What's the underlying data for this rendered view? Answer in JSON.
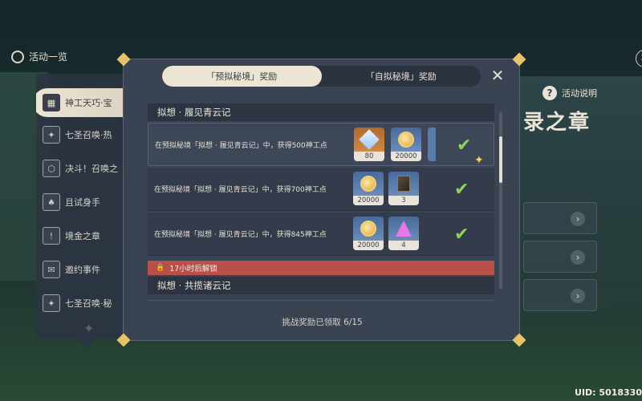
{
  "topbar": {
    "title": "活动一览"
  },
  "background": {
    "panel_title": "录之章",
    "help_label": "活动说明",
    "help_icon_glyph": "?"
  },
  "sidebar": {
    "items": [
      {
        "label": "神工天巧·宝",
        "icon": "grid-icon",
        "glyph": "▦",
        "active": true
      },
      {
        "label": "七圣召唤·热",
        "icon": "card-icon",
        "glyph": "✦"
      },
      {
        "label": "决斗！召唤之",
        "icon": "shield-icon",
        "glyph": "⬡"
      },
      {
        "label": "且试身手",
        "icon": "cards-icon",
        "glyph": "♠"
      },
      {
        "label": "境金之章",
        "icon": "exclaim-icon",
        "glyph": "!"
      },
      {
        "label": "邀约事件",
        "icon": "letter-icon",
        "glyph": "✉"
      },
      {
        "label": "七圣召唤·秘",
        "icon": "card-icon",
        "glyph": "✦"
      }
    ]
  },
  "modal": {
    "tabs": [
      {
        "label": "「预拟秘境」奖励",
        "active": true
      },
      {
        "label": "「自拟秘境」奖励",
        "active": false
      }
    ],
    "close_glyph": "✕",
    "sections": [
      {
        "title": "拟想 · 履见青云记"
      },
      {
        "title": "拟想 · 共揽诸云记"
      }
    ],
    "rows": [
      {
        "text": "在预拟秘境「拟想 · 履见青云记」中，获得500神工点",
        "rewards": [
          {
            "item": "gem-icon",
            "rarity": "orange",
            "qty": "80"
          },
          {
            "item": "coin-icon",
            "rarity": "blue",
            "qty": "20000"
          }
        ],
        "claimed": true
      },
      {
        "text": "在预拟秘境「拟想 · 履见青云记」中，获得700神工点",
        "rewards": [
          {
            "item": "coin-icon",
            "rarity": "blue",
            "qty": "20000"
          },
          {
            "item": "book-icon",
            "rarity": "blue",
            "qty": "3"
          }
        ],
        "claimed": true
      },
      {
        "text": "在预拟秘境「拟想 · 履见青云记」中，获得845神工点",
        "rewards": [
          {
            "item": "coin-icon",
            "rarity": "blue",
            "qty": "20000"
          },
          {
            "item": "crystal-icon",
            "rarity": "blue",
            "qty": "4"
          }
        ],
        "claimed": true
      }
    ],
    "lock": {
      "label": "17小时后解锁",
      "icon_glyph": "🔒"
    },
    "footer": "挑战奖励已领取 6/15"
  },
  "uid": "UID: 5018330",
  "colors": {
    "claimed_check": "#8fd35a",
    "lock_bar": "#b8504a",
    "tab_active": "#ece5d3"
  }
}
